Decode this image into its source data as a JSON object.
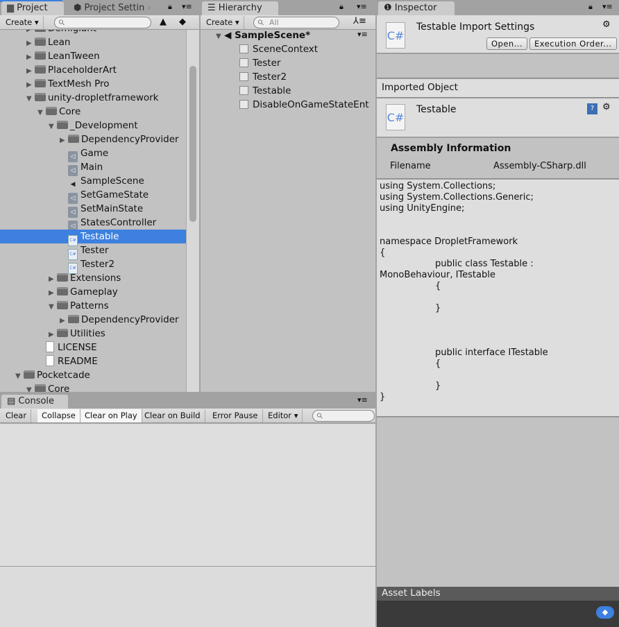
{
  "project": {
    "tab": "Project",
    "tab2": "Project Settin",
    "create": "Create",
    "items": [
      {
        "label": "Demigiant",
        "level": 1,
        "type": "folder",
        "arrow": "right"
      },
      {
        "label": "Lean",
        "level": 1,
        "type": "folder",
        "arrow": "right"
      },
      {
        "label": "LeanTween",
        "level": 1,
        "type": "folder",
        "arrow": "right"
      },
      {
        "label": "PlaceholderArt",
        "level": 1,
        "type": "folder",
        "arrow": "right"
      },
      {
        "label": "TextMesh Pro",
        "level": 1,
        "type": "folder",
        "arrow": "right"
      },
      {
        "label": "unity-dropletframework",
        "level": 1,
        "type": "folder",
        "arrow": "down"
      },
      {
        "label": "Core",
        "level": 2,
        "type": "folder",
        "arrow": "down"
      },
      {
        "label": "_Development",
        "level": 3,
        "type": "folder",
        "arrow": "down"
      },
      {
        "label": "DependencyProvider",
        "level": 4,
        "type": "folder",
        "arrow": "right"
      },
      {
        "label": "Game",
        "level": 4,
        "type": "asset",
        "arrow": ""
      },
      {
        "label": "Main",
        "level": 4,
        "type": "asset",
        "arrow": ""
      },
      {
        "label": "SampleScene",
        "level": 4,
        "type": "scene",
        "arrow": ""
      },
      {
        "label": "SetGameState",
        "level": 4,
        "type": "asset",
        "arrow": ""
      },
      {
        "label": "SetMainState",
        "level": 4,
        "type": "asset",
        "arrow": ""
      },
      {
        "label": "StatesController",
        "level": 4,
        "type": "asset",
        "arrow": ""
      },
      {
        "label": "Testable",
        "level": 4,
        "type": "script",
        "arrow": "",
        "selected": true
      },
      {
        "label": "Tester",
        "level": 4,
        "type": "script",
        "arrow": ""
      },
      {
        "label": "Tester2",
        "level": 4,
        "type": "script",
        "arrow": ""
      },
      {
        "label": "Extensions",
        "level": 3,
        "type": "folder",
        "arrow": "right"
      },
      {
        "label": "Gameplay",
        "level": 3,
        "type": "folder",
        "arrow": "right"
      },
      {
        "label": "Patterns",
        "level": 3,
        "type": "folder",
        "arrow": "down"
      },
      {
        "label": "DependencyProvider",
        "level": 4,
        "type": "folder",
        "arrow": "right"
      },
      {
        "label": "Utilities",
        "level": 3,
        "type": "folder",
        "arrow": "right"
      },
      {
        "label": "LICENSE",
        "level": 2,
        "type": "doc",
        "arrow": ""
      },
      {
        "label": "README",
        "level": 2,
        "type": "doc",
        "arrow": ""
      },
      {
        "label": "Pocketcade",
        "level": 0,
        "type": "folder",
        "arrow": "down"
      },
      {
        "label": "Core",
        "level": 1,
        "type": "folder",
        "arrow": "down"
      }
    ]
  },
  "hierarchy": {
    "tab": "Hierarchy",
    "create": "Create",
    "search_placeholder": "All",
    "scene": "SampleScene*",
    "items": [
      "SceneContext",
      "Tester",
      "Tester2",
      "Testable",
      "DisableOnGameStateEnt"
    ]
  },
  "console": {
    "tab": "Console",
    "buttons": [
      "Clear",
      "Collapse",
      "Clear on Play",
      "Clear on Build",
      "Error Pause",
      "Editor"
    ]
  },
  "inspector": {
    "tab": "Inspector",
    "title": "Testable Import Settings",
    "open": "Open...",
    "exec_order": "Execution Order...",
    "imported_object": "Imported Object",
    "object_name": "Testable",
    "assembly_info": "Assembly Information",
    "filename_label": "Filename",
    "filename_value": "Assembly-CSharp.dll",
    "csharp": "C#",
    "code": [
      "using System.Collections;",
      "using System.Collections.Generic;",
      "using UnityEngine;",
      "",
      "",
      "namespace DropletFramework",
      "{",
      "\tpublic class Testable :",
      "MonoBehaviour, ITestable",
      "\t{",
      "",
      "\t}",
      "",
      "",
      "",
      "\tpublic interface ITestable",
      "\t{",
      "",
      "\t}",
      "}"
    ],
    "asset_labels": "Asset Labels"
  },
  "colors": {
    "selection": "#3d80df"
  }
}
